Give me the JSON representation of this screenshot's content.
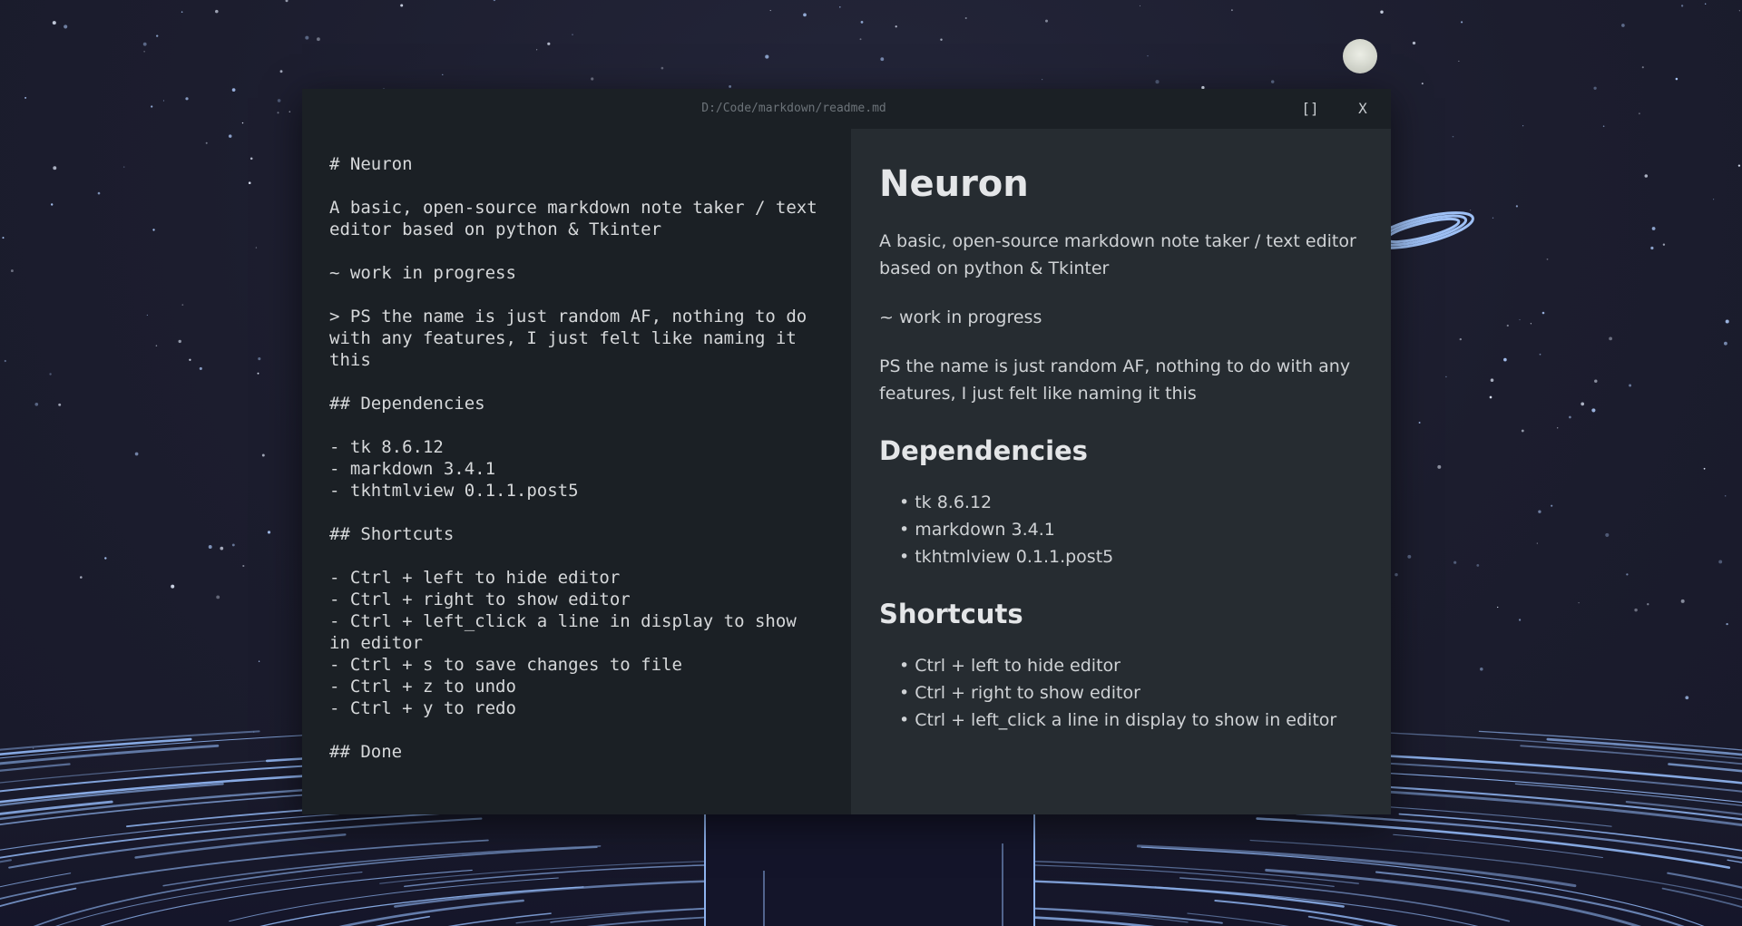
{
  "window": {
    "title": "D:/Code/markdown/readme.md",
    "maximize_label": "[]",
    "close_label": "X"
  },
  "editor": {
    "content": "# Neuron\n\nA basic, open-source markdown note taker / text editor based on python & Tkinter\n\n~ work in progress\n\n> PS the name is just random AF, nothing to do with any features, I just felt like naming it this\n\n## Dependencies\n\n- tk 8.6.12\n- markdown 3.4.1\n- tkhtmlview 0.1.1.post5\n\n## Shortcuts\n\n- Ctrl + left to hide editor\n- Ctrl + right to show editor\n- Ctrl + left_click a line in display to show in editor\n- Ctrl + s to save changes to file\n- Ctrl + z to undo\n- Ctrl + y to redo\n\n## Done"
  },
  "preview": {
    "title": "Neuron",
    "intro": "A basic, open-source markdown note taker / text editor based on python & Tkinter",
    "wip": "~ work in progress",
    "ps": "PS the name is just random AF, nothing to do with any features, I just felt like naming it this",
    "dependencies_heading": "Dependencies",
    "dependencies": [
      "tk 8.6.12",
      "markdown 3.4.1",
      "tkhtmlview 0.1.1.post5"
    ],
    "shortcuts_heading": "Shortcuts",
    "shortcuts": [
      "Ctrl + left to hide editor",
      "Ctrl + right to show editor",
      "Ctrl + left_click a line in display to show in editor"
    ],
    "bullet": "•"
  },
  "colors": {
    "window_bg": "#1b2025",
    "preview_bg": "#262c31",
    "text": "#d6d8da",
    "title_text": "#6c7379",
    "wallpaper_bg": "#1c1d2e",
    "accent_blue": "#8fb4f0"
  }
}
